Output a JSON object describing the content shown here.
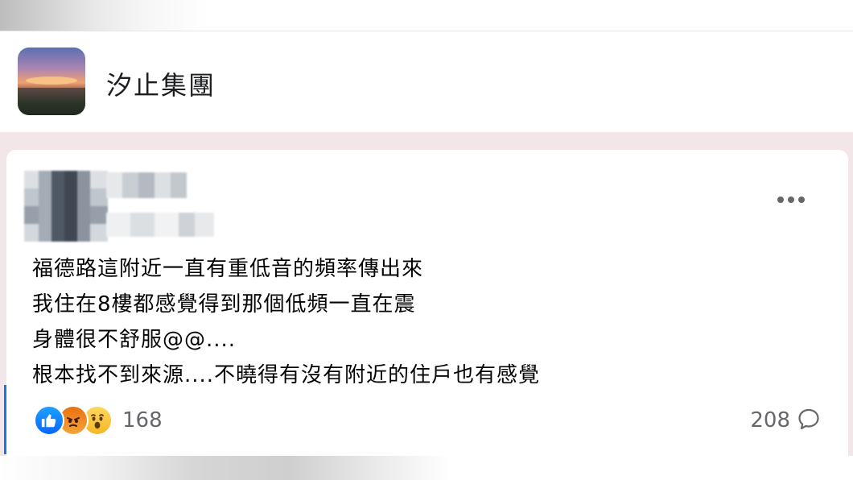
{
  "group": {
    "name": "汐止集團"
  },
  "post": {
    "lines": [
      "福德路這附近一直有重低音的頻率傳出來",
      "我住在8樓都感覺得到那個低頻一直在震",
      "身體很不舒服@@....",
      "根本找不到來源....不曉得有沒有附近的住戶也有感覺"
    ]
  },
  "reactions": {
    "types": [
      "like",
      "angry",
      "wow"
    ],
    "count": "168"
  },
  "comments": {
    "count": "208"
  },
  "colors": {
    "accent": "#1b74e4",
    "feed_background": "#f3e6e9",
    "secondary_text": "#65676b"
  }
}
